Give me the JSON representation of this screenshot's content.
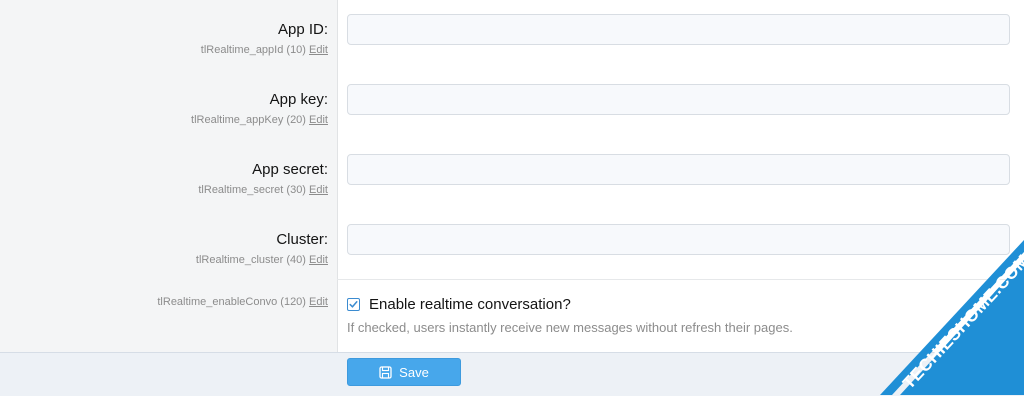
{
  "fields": [
    {
      "label": "App ID:",
      "hint_key": "tlRealtime_appId (10)",
      "edit": "Edit",
      "value": ""
    },
    {
      "label": "App key:",
      "hint_key": "tlRealtime_appKey (20)",
      "edit": "Edit",
      "value": ""
    },
    {
      "label": "App secret:",
      "hint_key": "tlRealtime_secret (30)",
      "edit": "Edit",
      "value": ""
    },
    {
      "label": "Cluster:",
      "hint_key": "tlRealtime_cluster (40)",
      "edit": "Edit",
      "value": ""
    }
  ],
  "convo_option": {
    "hint_key": "tlRealtime_enableConvo (120)",
    "edit": "Edit",
    "label": "Enable realtime conversation?",
    "checked": true,
    "explain": "If checked, users instantly receive new messages without refresh their pages."
  },
  "footer": {
    "save_label": "Save"
  },
  "watermark": {
    "text": "TECHIESHOME.COM",
    "color": "#1f8fd6"
  }
}
